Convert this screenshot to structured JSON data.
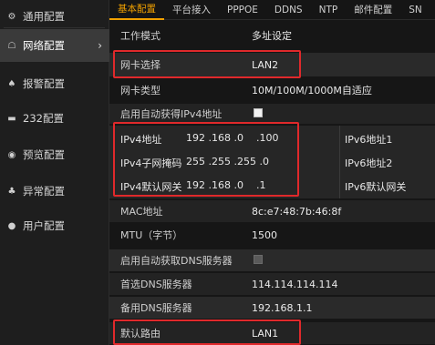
{
  "sidebar": {
    "items": [
      {
        "label": "通用配置",
        "icon": "gear-icon",
        "glyph": "⚙"
      },
      {
        "label": "网络配置",
        "icon": "network-icon",
        "glyph": "☖"
      },
      {
        "label": "报警配置",
        "icon": "alarm-icon",
        "glyph": "♠"
      },
      {
        "label": "232配置",
        "icon": "serial-port-icon",
        "glyph": "▬"
      },
      {
        "label": "预览配置",
        "icon": "eye-icon",
        "glyph": "◉"
      },
      {
        "label": "异常配置",
        "icon": "warning-icon",
        "glyph": "♣"
      },
      {
        "label": "用户配置",
        "icon": "user-icon",
        "glyph": "●"
      }
    ]
  },
  "tabs": [
    "基本配置",
    "平台接入",
    "PPPOE",
    "DDNS",
    "NTP",
    "邮件配置",
    "SN"
  ],
  "form": {
    "work_mode_label": "工作模式",
    "work_mode_value": "多址设定",
    "nic_label": "网卡选择",
    "nic_value": "LAN2",
    "nic_type_label": "网卡类型",
    "nic_type_value": "10M/100M/1000M自适应",
    "dhcp_label": "启用自动获得IPv4地址",
    "ipv4_addr_label": "IPv4地址",
    "ipv4_addr_value": "192 .168 .0    .100",
    "ipv4_mask_label": "IPv4子网掩码",
    "ipv4_mask_value": "255 .255 .255 .0",
    "ipv4_gw_label": "IPv4默认网关",
    "ipv4_gw_value": "192 .168 .0    .1",
    "ipv6_addr1_label": "IPv6地址1",
    "ipv6_addr2_label": "IPv6地址2",
    "ipv6_gw_label": "IPv6默认网关",
    "mac_label": "MAC地址",
    "mac_value": "8c:e7:48:7b:46:8f",
    "mtu_label": "MTU（字节）",
    "mtu_value": "1500",
    "auto_dns_label": "启用自动获取DNS服务器",
    "dns1_label": "首选DNS服务器",
    "dns1_value": "114.114.114.114",
    "dns2_label": "备用DNS服务器",
    "dns2_value": "192.168.1.1",
    "route_label": "默认路由",
    "route_value": "LAN1"
  },
  "colors": {
    "accent": "#f0a000",
    "highlight": "#e0292b"
  }
}
